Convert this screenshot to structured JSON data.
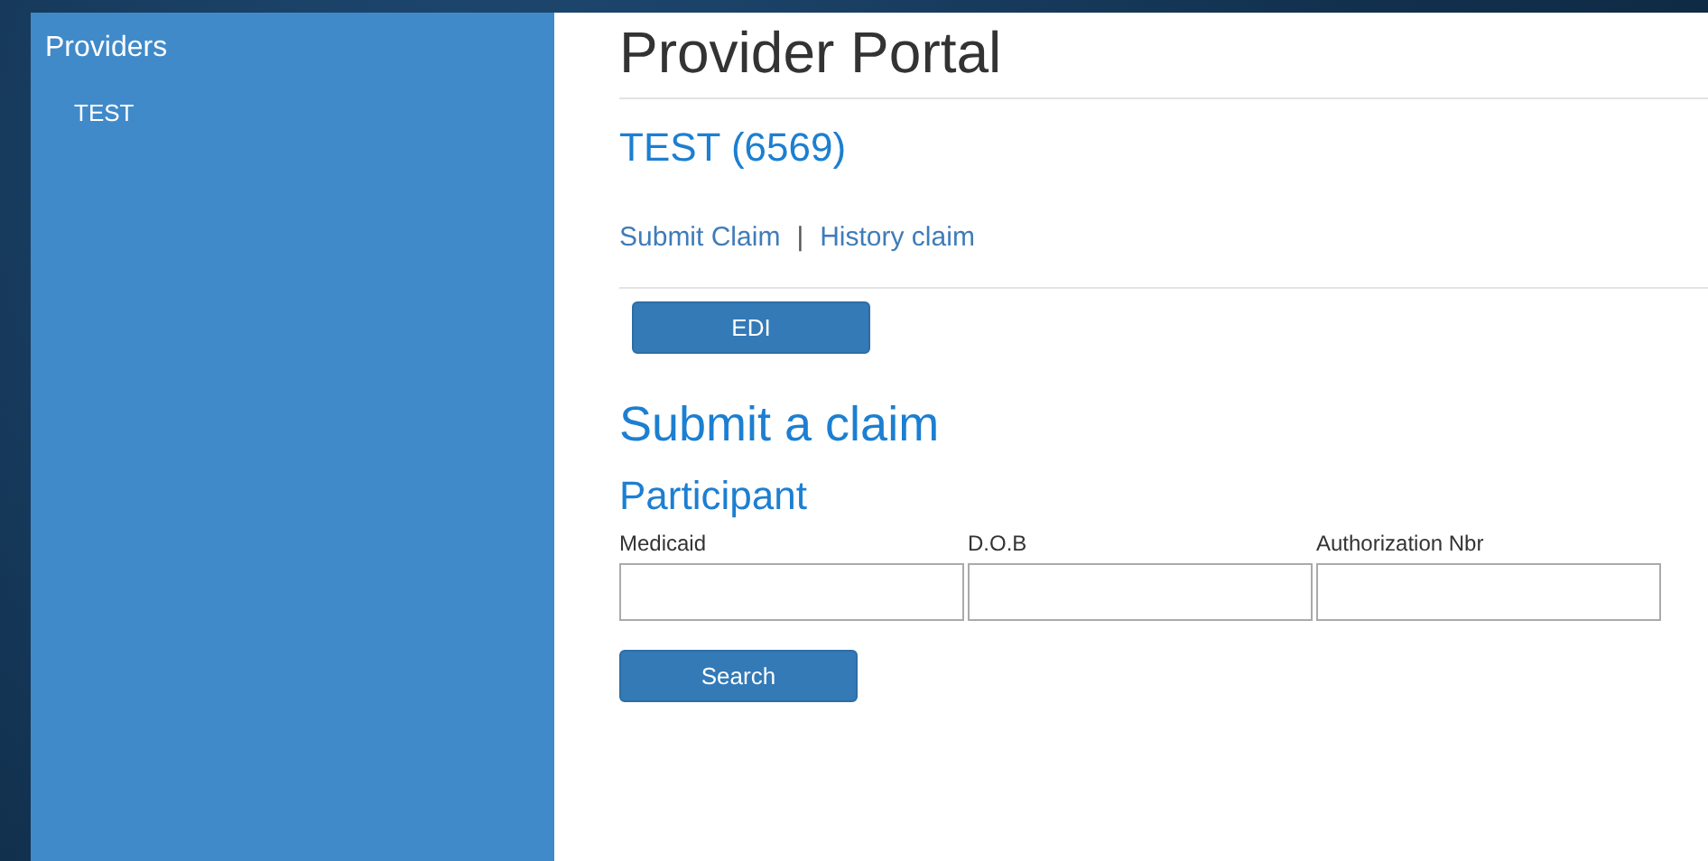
{
  "sidebar": {
    "title": "Providers",
    "items": [
      {
        "label": "TEST"
      }
    ]
  },
  "header": {
    "title": "Provider Portal"
  },
  "provider": {
    "name": "TEST (6569)"
  },
  "nav_links": [
    {
      "label": "Submit Claim"
    },
    {
      "label": "History claim"
    }
  ],
  "nav_separator": "|",
  "edi_button": "EDI",
  "form": {
    "title": "Submit a claim",
    "section": "Participant",
    "fields": [
      {
        "label": "Medicaid"
      },
      {
        "label": "D.O.B"
      },
      {
        "label": "Authorization Nbr"
      }
    ],
    "search_button": "Search"
  }
}
